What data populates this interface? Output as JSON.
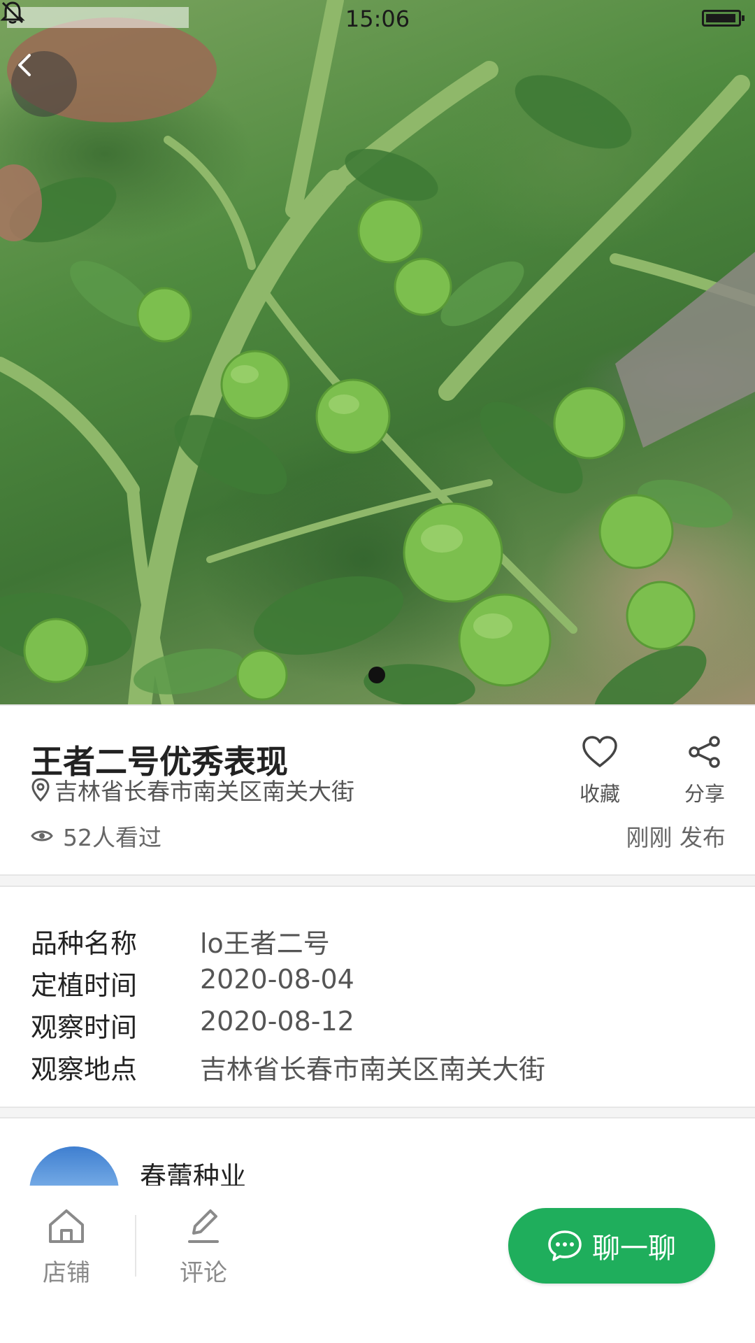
{
  "status_bar": {
    "time": "15:06"
  },
  "hero": {
    "image_alt": "",
    "page_indicator": {
      "current": 1,
      "total": 1
    }
  },
  "post": {
    "title": "王者二号优秀表现",
    "location": "吉林省长春市南关区南关大街",
    "views": "52人看过",
    "published": "刚刚 发布",
    "actions": {
      "favorite": "收藏",
      "share": "分享"
    }
  },
  "info": {
    "rows": [
      {
        "key": "品种名称",
        "value": "lo王者二号"
      },
      {
        "key": "定植时间",
        "value": "2020-08-04"
      },
      {
        "key": "观察时间",
        "value": "2020-08-12"
      },
      {
        "key": "观察地点",
        "value": "吉林省长春市南关区南关大街"
      }
    ]
  },
  "shop": {
    "name": "春蕾种业"
  },
  "bottom_bar": {
    "shop_label": "店铺",
    "comment_label": "评论",
    "chat_label": "聊一聊"
  },
  "colors": {
    "accent": "#1fae5c",
    "text_primary": "#222222",
    "text_secondary": "#666666"
  }
}
